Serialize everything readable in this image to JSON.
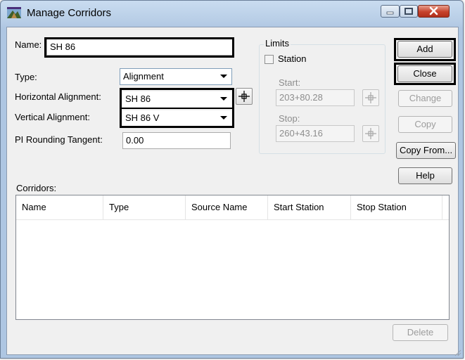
{
  "window": {
    "title": "Manage Corridors"
  },
  "name_field": {
    "label": "Name:",
    "value": "SH 86"
  },
  "type_field": {
    "label": "Type:",
    "value": "Alignment"
  },
  "horizontal_alignment": {
    "label": "Horizontal Alignment:",
    "value": "SH 86"
  },
  "vertical_alignment": {
    "label": "Vertical Alignment:",
    "value": "SH 86 V"
  },
  "pi_rounding": {
    "label": "PI Rounding Tangent:",
    "value": "0.00"
  },
  "limits": {
    "label": "Limits",
    "station_label": "Station",
    "station_checked": false,
    "start_label": "Start:",
    "start_value": "203+80.28",
    "stop_label": "Stop:",
    "stop_value": "260+43.16"
  },
  "buttons": {
    "add": "Add",
    "close": "Close",
    "change": "Change",
    "copy": "Copy",
    "copy_from": "Copy From...",
    "help": "Help",
    "delete": "Delete"
  },
  "corridors": {
    "label": "Corridors:",
    "columns": [
      "Name",
      "Type",
      "Source Name",
      "Start Station",
      "Stop Station"
    ],
    "rows": []
  }
}
